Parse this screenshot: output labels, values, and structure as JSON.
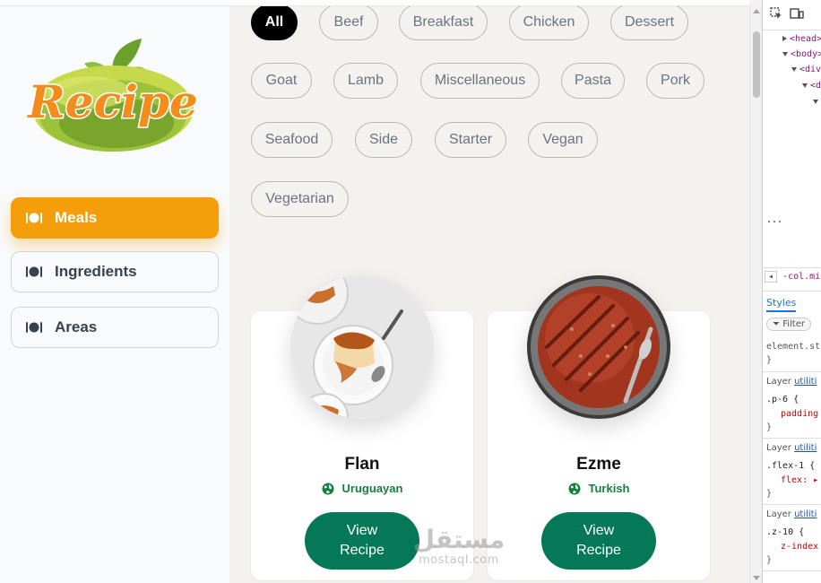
{
  "sidebar": {
    "logo_text": "Recipe",
    "nav": [
      {
        "label": "Meals",
        "active": true
      },
      {
        "label": "Ingredients",
        "active": false
      },
      {
        "label": "Areas",
        "active": false
      }
    ]
  },
  "categories": [
    "All",
    "Beef",
    "Breakfast",
    "Chicken",
    "Dessert",
    "Goat",
    "Lamb",
    "Miscellaneous",
    "Pasta",
    "Pork",
    "Seafood",
    "Side",
    "Starter",
    "Vegan",
    "Vegetarian"
  ],
  "active_category": "All",
  "meals": [
    {
      "name": "Flan",
      "area": "Uruguayan",
      "button_line1": "View",
      "button_line2": "Recipe"
    },
    {
      "name": "Ezme",
      "area": "Turkish",
      "button_line1": "View",
      "button_line2": "Recipe"
    }
  ],
  "colors": {
    "accent": "#f59e0b",
    "primary_button": "#047857",
    "area_text": "#15803d",
    "active_chip": "#000000"
  },
  "watermark": {
    "line1": "مستقل",
    "line2": "mostaql.com"
  },
  "devtools": {
    "elements": [
      "<head>",
      "<body>",
      "<div",
      "<d"
    ],
    "ellipsis": "...",
    "class_crumb": "-col.mi",
    "tab_styles": "Styles",
    "filter_placeholder": "Filter",
    "element_style": "element.st",
    "brace": "}",
    "layer_label": "Layer",
    "layer_link": "utiliti",
    "rules": [
      {
        "selector": ".p-6 {",
        "prop": "padding"
      },
      {
        "selector": ".flex-1 {",
        "prop": "flex: ▸"
      },
      {
        "selector": ".z-10 {",
        "prop": "z-index"
      }
    ]
  }
}
